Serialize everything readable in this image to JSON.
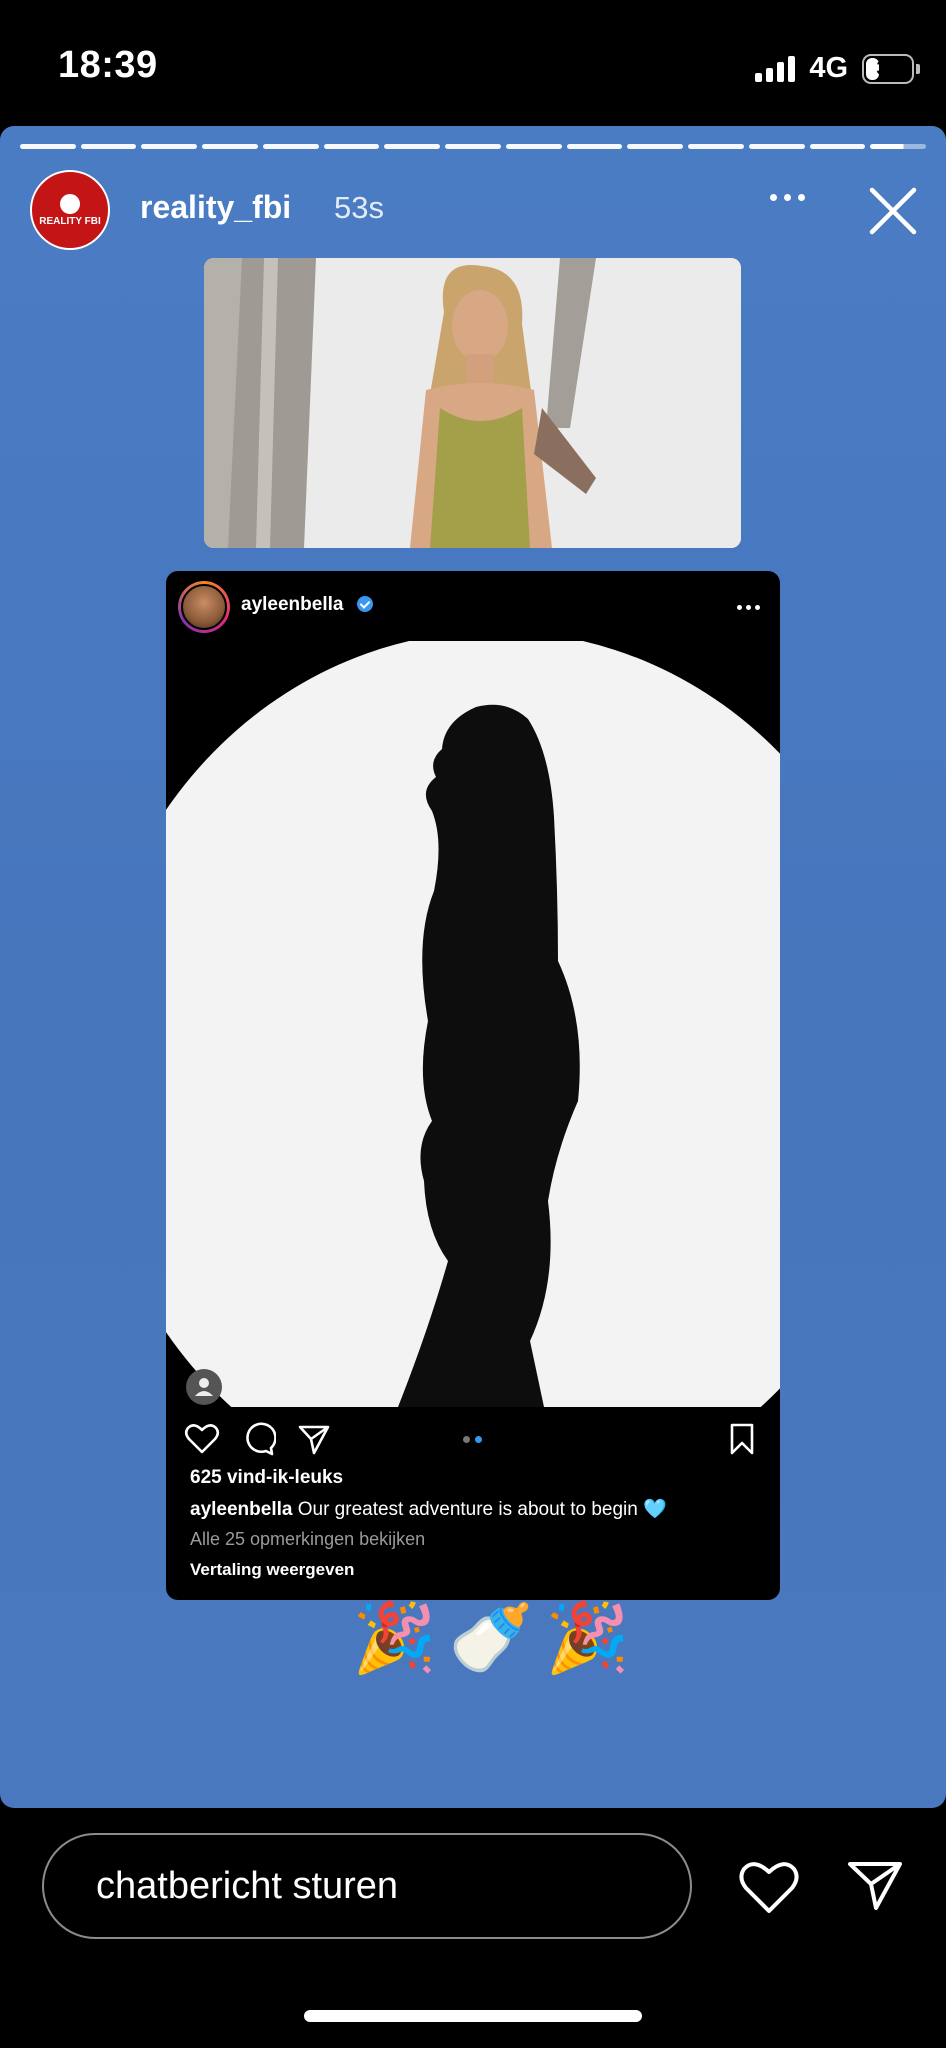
{
  "status_bar": {
    "time": "18:39",
    "network": "4G",
    "battery": "35",
    "battery_level": 0.35
  },
  "story": {
    "username": "reality_fbi",
    "time_ago": "53s",
    "avatar_text": "REALITY FBI",
    "progress_segments": 15,
    "background_color": "#4a7cc4"
  },
  "post": {
    "username": "ayleenbella",
    "verified": true,
    "likes": "625 vind-ik-leuks",
    "caption_user": "ayleenbella",
    "caption_text": "Our greatest adventure is about to begin 🩵",
    "comments_link": "Alle 25 opmerkingen bekijken",
    "translate_link": "Vertaling weergeven",
    "carousel_active": 1,
    "carousel_count": 2
  },
  "stickers": [
    "🎉",
    "🍼",
    "🎉"
  ],
  "bottom": {
    "message_placeholder": "chatbericht sturen"
  },
  "icons": [
    "signal-icon",
    "battery-icon",
    "more-icon",
    "close-icon",
    "heart-icon",
    "comment-icon",
    "share-icon",
    "bookmark-icon",
    "send-icon",
    "verified-icon",
    "user-tag-icon"
  ]
}
